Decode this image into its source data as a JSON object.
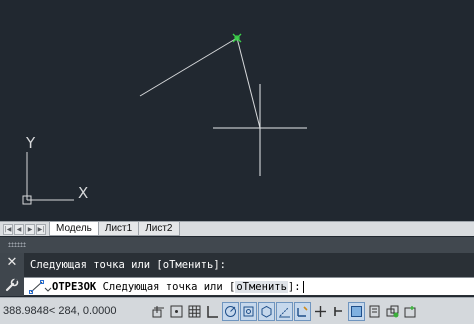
{
  "drawing": {
    "ucs_axis_x": "X",
    "ucs_axis_y": "Y",
    "colors": {
      "background": "#212830",
      "line": "#d6d8da",
      "snap_marker": "#3cd04a",
      "crosshair": "#e8eaec"
    }
  },
  "layout_tabs": {
    "nav_buttons": [
      "first",
      "previous",
      "next",
      "last"
    ],
    "tabs": [
      "Модель",
      "Лист1",
      "Лист2"
    ],
    "active": "Модель"
  },
  "command": {
    "history_line": "Следующая точка или [оТменить]:",
    "command_name": "ОТРЕЗОК",
    "prompt": " Следующая точка или [",
    "option": "оТменить",
    "prompt_end": "]:"
  },
  "status_bar": {
    "coordinates": "388.9848< 284, 0.0000",
    "tools": [
      {
        "name": "infer-constraints",
        "on": false
      },
      {
        "name": "snap",
        "on": false
      },
      {
        "name": "grid",
        "on": false
      },
      {
        "name": "ortho",
        "on": false
      },
      {
        "name": "polar",
        "on": true
      },
      {
        "name": "osnap",
        "on": true
      },
      {
        "name": "3d-osnap",
        "on": true
      },
      {
        "name": "otrack",
        "on": true
      },
      {
        "name": "dynamic-ucs",
        "on": true
      },
      {
        "name": "dynamic-input",
        "on": false
      },
      {
        "name": "lineweight",
        "on": false
      },
      {
        "name": "transparency",
        "on": true
      },
      {
        "name": "quick-properties",
        "on": false
      },
      {
        "name": "selection-cycling",
        "on": false
      },
      {
        "name": "annotation-monitor",
        "on": false
      }
    ]
  }
}
